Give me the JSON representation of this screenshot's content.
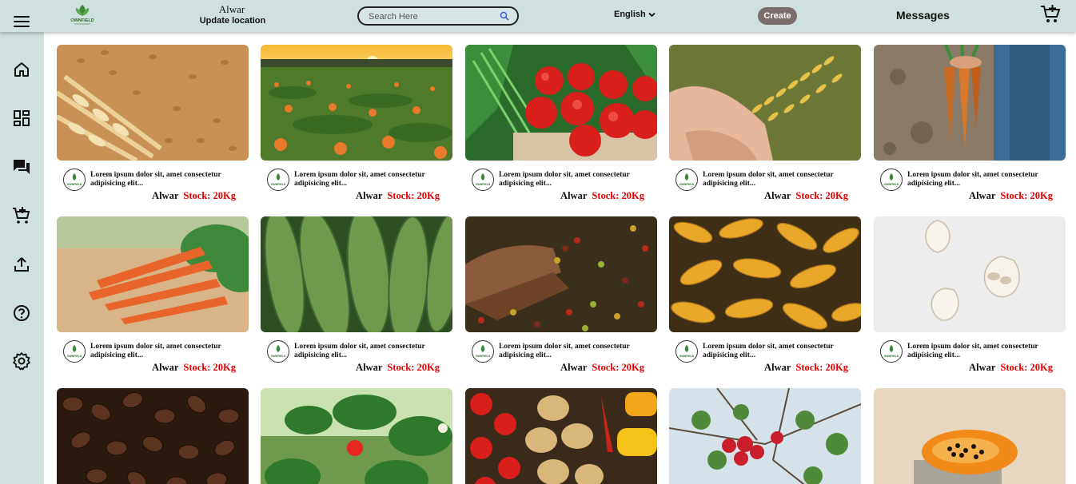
{
  "header": {
    "logo_text": "OWNFIELD",
    "location_city": "Alwar",
    "update_location_label": "Update location",
    "search_placeholder": "Search Here",
    "language": "English",
    "create_label": "Create",
    "messages_label": "Messages"
  },
  "sidebar": {
    "items": [
      {
        "icon": "home-icon"
      },
      {
        "icon": "dashboard-icon"
      },
      {
        "icon": "chat-icon"
      },
      {
        "icon": "add-cart-icon"
      },
      {
        "icon": "upload-icon"
      },
      {
        "icon": "help-icon"
      },
      {
        "icon": "settings-icon"
      }
    ]
  },
  "products": [
    {
      "image": "wheat",
      "description": "Lorem ipsum dolor sit, amet consectetur adipisicing elit...",
      "city": "Alwar",
      "stock": "Stock: 20Kg"
    },
    {
      "image": "pumpkin-field",
      "description": "Lorem ipsum dolor sit, amet consectetur adipisicing elit...",
      "city": "Alwar",
      "stock": "Stock: 20Kg"
    },
    {
      "image": "tomatoes",
      "description": "Lorem ipsum dolor sit, amet consectetur adipisicing elit...",
      "city": "Alwar",
      "stock": "Stock: 20Kg"
    },
    {
      "image": "rice-grain",
      "description": "Lorem ipsum dolor sit, amet consectetur adipisicing elit...",
      "city": "Alwar",
      "stock": "Stock: 20Kg"
    },
    {
      "image": "carrots-harvest",
      "description": "Lorem ipsum dolor sit, amet consectetur adipisicing elit...",
      "city": "Alwar",
      "stock": "Stock: 20Kg"
    },
    {
      "image": "carrots",
      "description": "Lorem ipsum dolor sit, amet consectetur adipisicing elit...",
      "city": "Alwar",
      "stock": "Stock: 20Kg"
    },
    {
      "image": "cucumbers",
      "description": "Lorem ipsum dolor sit, amet consectetur adipisicing elit...",
      "city": "Alwar",
      "stock": "Stock: 20Kg"
    },
    {
      "image": "coffee-cherries",
      "description": "Lorem ipsum dolor sit, amet consectetur adipisicing elit...",
      "city": "Alwar",
      "stock": "Stock: 20Kg"
    },
    {
      "image": "corn",
      "description": "Lorem ipsum dolor sit, amet consectetur adipisicing elit...",
      "city": "Alwar",
      "stock": "Stock: 20Kg"
    },
    {
      "image": "garlic",
      "description": "Lorem ipsum dolor sit, amet consectetur adipisicing elit...",
      "city": "Alwar",
      "stock": "Stock: 20Kg"
    },
    {
      "image": "coffee-beans"
    },
    {
      "image": "strawberry-plant"
    },
    {
      "image": "mixed-vegetables"
    },
    {
      "image": "apple-tree"
    },
    {
      "image": "papaya"
    }
  ]
}
